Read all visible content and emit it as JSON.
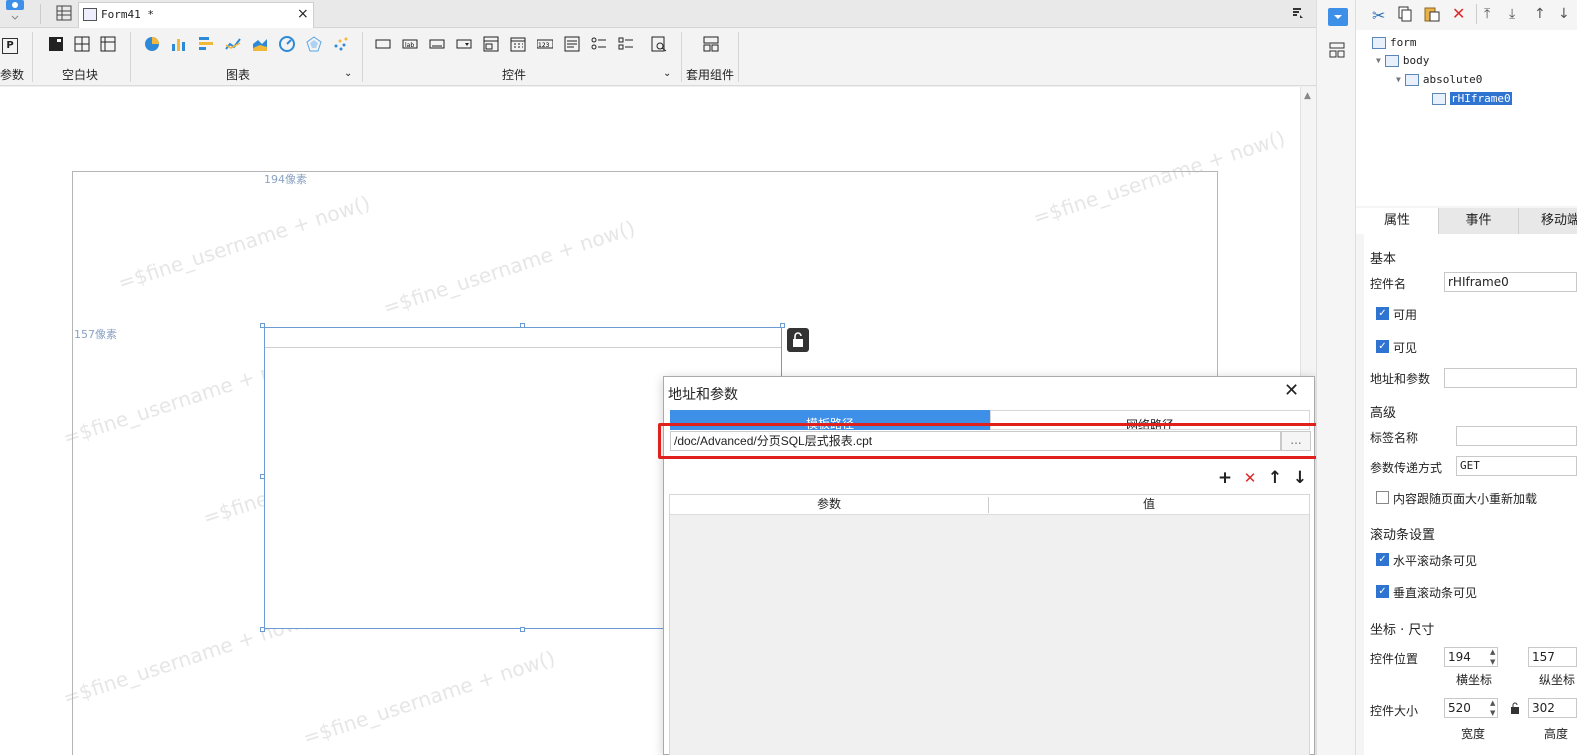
{
  "tabbar": {
    "doc_tab": "Form41 *",
    "close": "×"
  },
  "ribbon": {
    "groups": {
      "params": "参数",
      "blank": "空白块",
      "charts": "图表",
      "controls": "控件",
      "templates": "套用组件"
    },
    "params_icon_text": "P"
  },
  "canvas": {
    "x_ruler": "194像素",
    "y_ruler": "157像素",
    "watermark": "=$fine_username + now()"
  },
  "tree": {
    "items": [
      "form",
      "body",
      "absolute0",
      "rHIframe0"
    ]
  },
  "props": {
    "tabs": [
      "属性",
      "事件",
      "移动端"
    ],
    "basic": "基本",
    "name_label": "控件名",
    "name_value": "rHIframe0",
    "enabled": "可用",
    "visible": "可见",
    "url_params": "地址和参数",
    "advanced": "高级",
    "tag_name": "标签名称",
    "param_method": "参数传递方式",
    "param_method_value": "GET",
    "reload_on_resize": "内容跟随页面大小重新加载",
    "scroll_settings": "滚动条设置",
    "h_scroll": "水平滚动条可见",
    "v_scroll": "垂直滚动条可见",
    "coord_size": "坐标 · 尺寸",
    "position_label": "控件位置",
    "x_value": "194",
    "y_value": "157",
    "x_caption": "横坐标",
    "y_caption": "纵坐标",
    "size_label": "控件大小",
    "width_value": "520",
    "height_value": "302",
    "width_caption": "宽度",
    "height_caption": "高度"
  },
  "dialog": {
    "title": "地址和参数",
    "tab_template": "模板路径",
    "tab_network": "网络路径",
    "path_value": "/doc/Advanced/分页SQL层式报表.cpt",
    "browse": "...",
    "col_param": "参数",
    "col_value": "值",
    "add": "+",
    "remove": "✕",
    "up": "↑",
    "down": "↓",
    "close": "✕"
  },
  "colors": {
    "accent": "#3d8fe8",
    "highlight_box": "#e0201c",
    "selection": "#6c9bd2"
  }
}
